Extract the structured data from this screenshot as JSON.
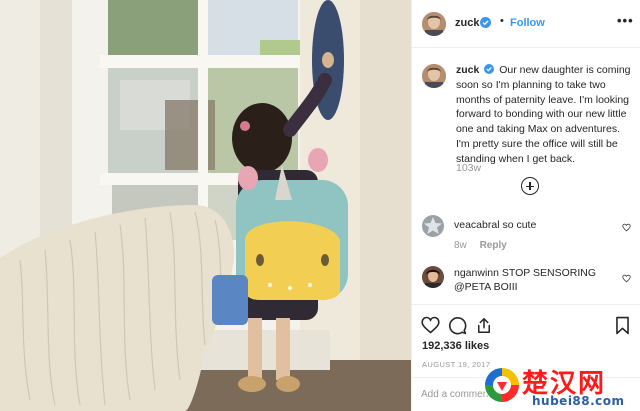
{
  "post": {
    "username": "zuck",
    "follow_label": "Follow",
    "separator": "•",
    "more_label": "•••"
  },
  "caption": {
    "username": "zuck",
    "text": "Our new daughter is coming soon so I'm planning to take two months of paternity leave. I'm looking forward to bonding with our new little one and taking Max on adventures. I'm pretty sure the office will still be standing when I get back.",
    "time": "103w"
  },
  "comments": [
    {
      "username": "veacabral",
      "text": "so cute",
      "time": "8w",
      "reply_label": "Reply"
    },
    {
      "username": "nganwinn",
      "text": "STOP SENSORING @PETA BOIII",
      "time": "",
      "reply_label": ""
    }
  ],
  "actions": {
    "likes": "192,336 likes",
    "date": "AUGUST 19, 2017",
    "comment_placeholder": "Add a comment..."
  },
  "icons": {
    "verified": "verified-badge-icon",
    "like": "heart-icon",
    "comment": "speech-bubble-icon",
    "share": "share-icon",
    "save": "bookmark-icon",
    "load_more": "plus-circle-icon"
  },
  "colors": {
    "link_blue": "#3897f0",
    "verified_blue": "#3897f0",
    "text": "#262626",
    "muted": "#999999",
    "border": "#efefef",
    "watermark_red": "#ff1a1a"
  },
  "watermark": {
    "title": "楚汉网",
    "url": "hubei88.com"
  }
}
